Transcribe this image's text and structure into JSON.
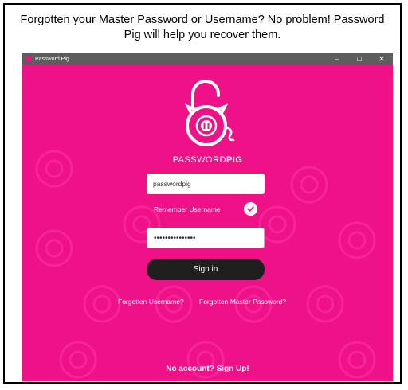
{
  "caption": "Forgotten your Master Password or Username? No problem! Password Pig will help you recover them.",
  "window": {
    "title": "Password Pig",
    "controls": {
      "minimize": "–",
      "maximize": "□",
      "close": "✕"
    }
  },
  "brand": {
    "prefix": "PASSWORD",
    "suffix": "PIG"
  },
  "login": {
    "username_value": "passwordpig",
    "remember_label": "Remember Username",
    "remember_checked": true,
    "password_mask": "•••••••••••••••",
    "signin_label": "Sign in"
  },
  "links": {
    "forgot_username": "Forgotten Username?",
    "forgot_master": "Forgotten Master Password?",
    "signup": "No account? Sign Up!"
  },
  "colors": {
    "background": "#ee1188",
    "button": "#1f1f1f"
  }
}
